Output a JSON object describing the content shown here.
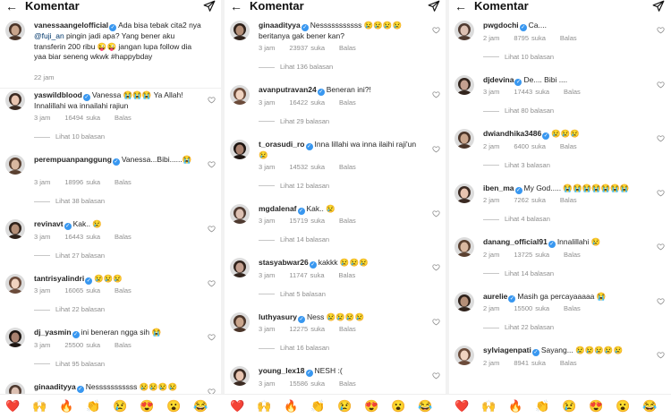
{
  "header": {
    "title": "Komentar",
    "back_icon": "arrow-left-icon",
    "send_icon": "paper-plane-icon"
  },
  "ui": {
    "reply_label": "Balas",
    "likes_suffix": "suka"
  },
  "colors": {
    "verified": "#3897f0",
    "meta": "#8e8e8e",
    "mention": "#00376b"
  },
  "panels": [
    {
      "caption": {
        "user": "vanessaangelofficial",
        "text_before": "Ada bisa tebak cita2 nya ",
        "mention": "@fuji_an",
        "text_after": " pingin jadi apa? Yang bener aku transferin 200 ribu 😜😜 jangan lupa follow dia yaa biar seneng wkwk #happybday",
        "time": "22 jam"
      },
      "comments": [
        {
          "user": "yaswildblood",
          "text": "Vanessa 😭😭😭 Ya Allah! Innalillahi wa innailahi rajiun",
          "time": "3 jam",
          "likes": "16494",
          "replies": "Lihat 10 balasan"
        },
        {
          "user": "perempuanpanggung",
          "text": "Vanessa...Bibi......😭",
          "time": "3 jam",
          "likes": "18996",
          "replies": "Lihat 38 balasan"
        },
        {
          "user": "revinavt",
          "text": "Kak.. 😢",
          "time": "3 jam",
          "likes": "16443",
          "replies": "Lihat 27 balasan"
        },
        {
          "user": "tantrisyalindri",
          "text": "😢😢😢",
          "time": "3 jam",
          "likes": "16065",
          "replies": "Lihat 22 balasan"
        },
        {
          "user": "dj_yasmin",
          "text": "ini beneran ngga sih 😭",
          "time": "3 jam",
          "likes": "25500",
          "replies": "Lihat 95 balasan"
        },
        {
          "user": "ginaadityya",
          "text": "Nesssssssssss 😢😢😢😢",
          "time": "",
          "likes": "",
          "replies": ""
        }
      ]
    },
    {
      "comments": [
        {
          "user": "ginaadityya",
          "text": "Nesssssssssss 😢😢😢😢 beritanya gak bener kan?",
          "time": "3 jam",
          "likes": "23937",
          "replies": "Lihat 136 balasan"
        },
        {
          "user": "avanputravan24",
          "text": "Beneran ini?!",
          "time": "3 jam",
          "likes": "16422",
          "replies": "Lihat 29 balasan"
        },
        {
          "user": "t_orasudi_ro",
          "text": "Inna lillahi wa inna ilaihi raji'un 😢",
          "time": "3 jam",
          "likes": "14532",
          "replies": "Lihat 12 balasan"
        },
        {
          "user": "mgdalenaf",
          "text": "Kak.. 😢",
          "time": "3 jam",
          "likes": "15719",
          "replies": "Lihat 14 balasan"
        },
        {
          "user": "stasyabwar26",
          "text": "kakkk 😢😢😢",
          "time": "3 jam",
          "likes": "11747",
          "replies": "Lihat 5 balasan"
        },
        {
          "user": "luthyasury",
          "text": "Ness 😢😢😢😢",
          "time": "3 jam",
          "likes": "12275",
          "replies": "Lihat 16 balasan"
        },
        {
          "user": "young_lex18",
          "text": "NESH :(",
          "time": "3 jam",
          "likes": "15586",
          "replies": ""
        }
      ]
    },
    {
      "comments": [
        {
          "user": "pwgdochi",
          "text": "Ca....",
          "time": "2 jam",
          "likes": "8795",
          "replies": "Lihat 10 balasan"
        },
        {
          "user": "djdevina",
          "text": "De.... Bibi ....",
          "time": "3 jam",
          "likes": "17443",
          "replies": "Lihat 80 balasan"
        },
        {
          "user": "dwiandhika3486",
          "text": "😢😢😢",
          "time": "2 jam",
          "likes": "6400",
          "replies": "Lihat 3 balasan"
        },
        {
          "user": "iben_ma",
          "text": "My God..... 😭😭😭😭😭😭😭",
          "time": "2 jam",
          "likes": "7262",
          "replies": "Lihat 4 balasan"
        },
        {
          "user": "danang_official91",
          "text": "Innalillahi 😢",
          "time": "2 jam",
          "likes": "13725",
          "replies": "Lihat 14 balasan"
        },
        {
          "user": "aurelie",
          "text": "Masih ga percayaaaaa 😭",
          "time": "2 jam",
          "likes": "15500",
          "replies": "Lihat 22 balasan"
        },
        {
          "user": "sylviagenpati",
          "text": "Sayang... 😢😢😢😢😢",
          "time": "2 jam",
          "likes": "8941",
          "replies": ""
        }
      ]
    }
  ],
  "emoji_bar": [
    "❤️",
    "🙌",
    "🔥",
    "👏",
    "😢",
    "😍",
    "😮",
    "😂"
  ]
}
